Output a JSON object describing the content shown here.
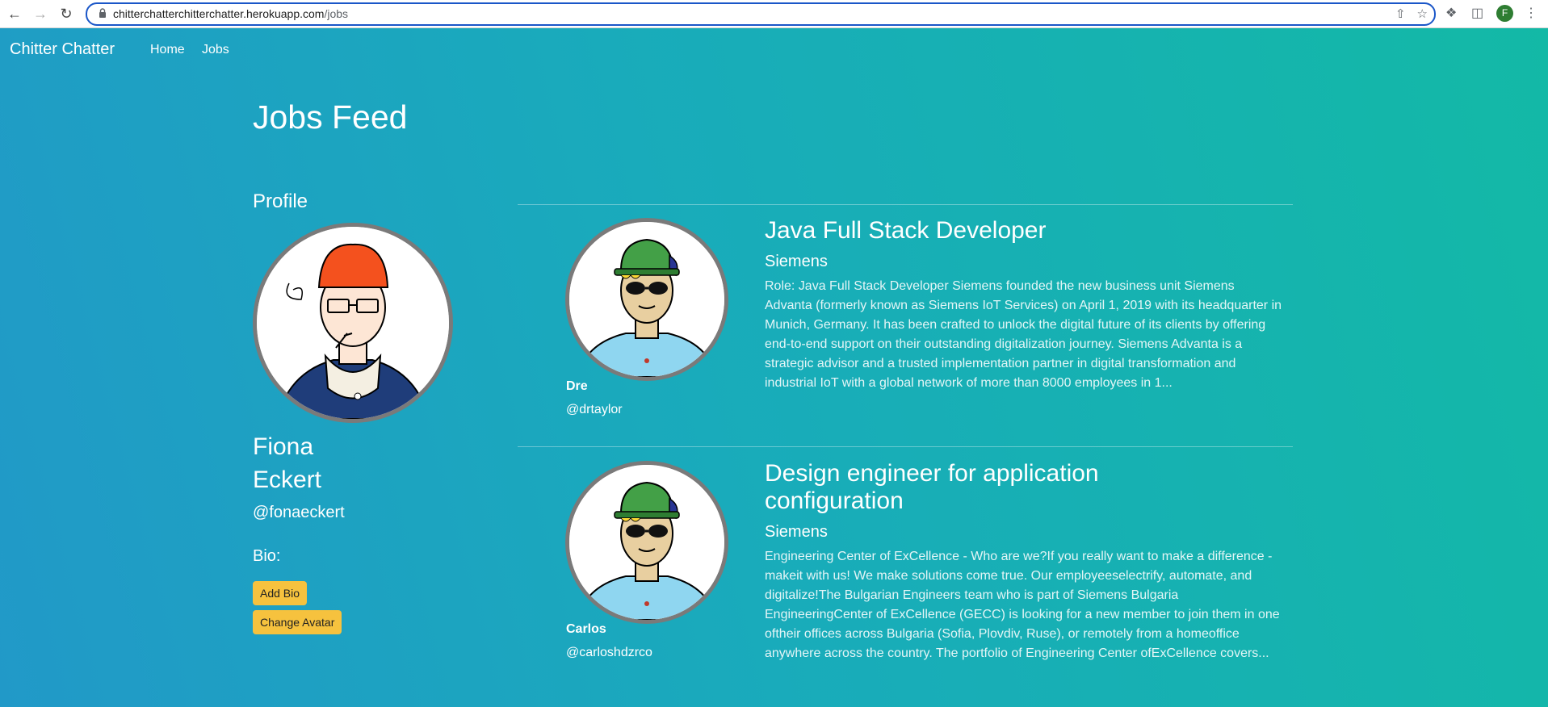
{
  "browser": {
    "url_host": "chitterchatterchitterchatter.herokuapp.com",
    "url_path": "/jobs",
    "profile_initial": "F"
  },
  "nav": {
    "brand": "Chitter Chatter",
    "links": [
      "Home",
      "Jobs"
    ]
  },
  "page": {
    "title": "Jobs Feed"
  },
  "profile": {
    "heading": "Profile",
    "first_name": "Fiona",
    "last_name": "Eckert",
    "handle": "@fonaeckert",
    "bio_label": "Bio:",
    "add_bio_label": "Add Bio",
    "change_avatar_label": "Change Avatar"
  },
  "jobs": [
    {
      "poster_name": "Dre",
      "poster_handle": "@drtaylor",
      "title": "Java Full Stack Developer",
      "company": "Siemens",
      "description": "Role: Java Full Stack Developer Siemens founded the new business unit Siemens Advanta (formerly known as Siemens IoT Services) on April 1, 2019 with its headquarter in Munich, Germany. It has been crafted to unlock the digital future of its clients by offering end-to-end support on their outstanding digitalization journey. Siemens Advanta is a strategic advisor and a trusted implementation partner in digital transformation and industrial IoT with a global network of more than 8000 employees in 1..."
    },
    {
      "poster_name": "Carlos",
      "poster_handle": "@carloshdzrco",
      "title": "Design engineer for application configuration",
      "company": "Siemens",
      "description": "Engineering Center of ExCellence - Who are we?If you really want to make a difference - makeit with us! We make solutions come true. Our employeeselectrify, automate, and digitalize!The Bulgarian Engineers team who is part of Siemens Bulgaria EngineeringCenter of ExCellence (GECC) is looking for a new member to join them in one oftheir offices across Bulgaria (Sofia, Plovdiv, Ruse), or remotely from a homeoffice anywhere across the country. The portfolio of Engineering Center ofExCellence covers..."
    }
  ]
}
